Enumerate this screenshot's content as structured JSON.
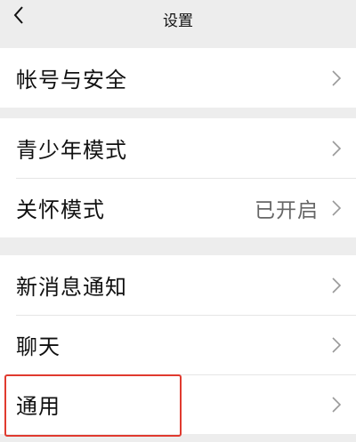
{
  "navbar": {
    "title": "设置",
    "back_icon": "chevron-left-icon"
  },
  "sections": [
    {
      "items": [
        {
          "label": "帐号与安全",
          "value": ""
        }
      ]
    },
    {
      "items": [
        {
          "label": "青少年模式",
          "value": ""
        },
        {
          "label": "关怀模式",
          "value": "已开启"
        }
      ]
    },
    {
      "items": [
        {
          "label": "新消息通知",
          "value": ""
        },
        {
          "label": "聊天",
          "value": ""
        },
        {
          "label": "通用",
          "value": ""
        }
      ]
    }
  ],
  "colors": {
    "background": "#ededed",
    "row_background": "#ffffff",
    "highlight_border": "#e03a2f"
  }
}
